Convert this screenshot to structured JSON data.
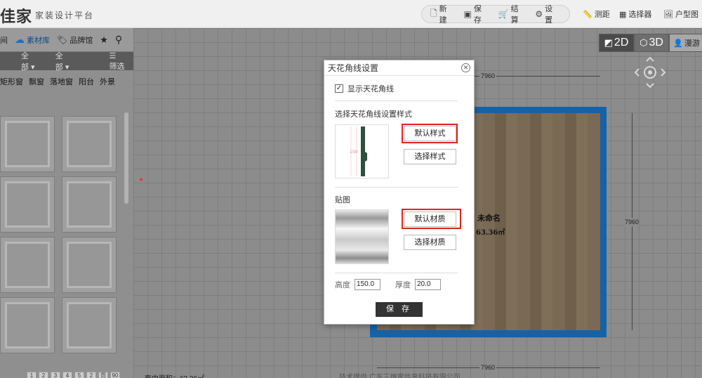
{
  "topbar": {
    "logo": "佳家",
    "platform": "家装设计平台",
    "actions": [
      {
        "label": "新建",
        "icon": "new-file-icon"
      },
      {
        "label": "保存",
        "icon": "save-icon"
      },
      {
        "label": "结算",
        "icon": "cart-icon"
      },
      {
        "label": "设置",
        "icon": "gear-icon"
      }
    ],
    "tools": [
      {
        "label": "测距",
        "icon": "ruler-icon"
      },
      {
        "label": "选择器",
        "icon": "selector-icon"
      },
      {
        "label": "户型图",
        "icon": "floorplan-icon"
      }
    ]
  },
  "left_panel": {
    "tabs": [
      {
        "label": "间"
      },
      {
        "label": "素材库",
        "icon": "cloud-icon"
      },
      {
        "label": "品牌馆",
        "icon": "tag-icon"
      }
    ],
    "filters": [
      "全部 ▾",
      "全部 ▾",
      "筛选"
    ],
    "categories": [
      "矩形窗",
      "飘窗",
      "落地窗",
      "阳台",
      "外景"
    ],
    "pager": [
      "1",
      "2",
      "3",
      "4",
      "5",
      "2",
      "页",
      "90"
    ]
  },
  "canvas": {
    "room_name": "未命名",
    "room_area": "63.36㎡",
    "dimensions": {
      "top": "7960",
      "right": "7960",
      "bottom": "7960"
    },
    "view_modes": [
      "2D",
      "3D",
      "漫游"
    ],
    "footer": "技术提供:广东三维家信息科技有限公司",
    "area_label": "套内面积：63.36㎡"
  },
  "dialog": {
    "title": "天花角线设置",
    "show_label": "显示天花角线",
    "show_checked": true,
    "style_section": "选择天花角线设置样式",
    "default_style_btn": "默认样式",
    "choose_style_btn": "选择样式",
    "texture_section": "贴图",
    "default_material_btn": "默认材质",
    "choose_material_btn": "选择材质",
    "height_label": "高度",
    "height_value": "150.0",
    "thickness_label": "厚度",
    "thickness_value": "20.0",
    "save_btn": "保 存"
  }
}
